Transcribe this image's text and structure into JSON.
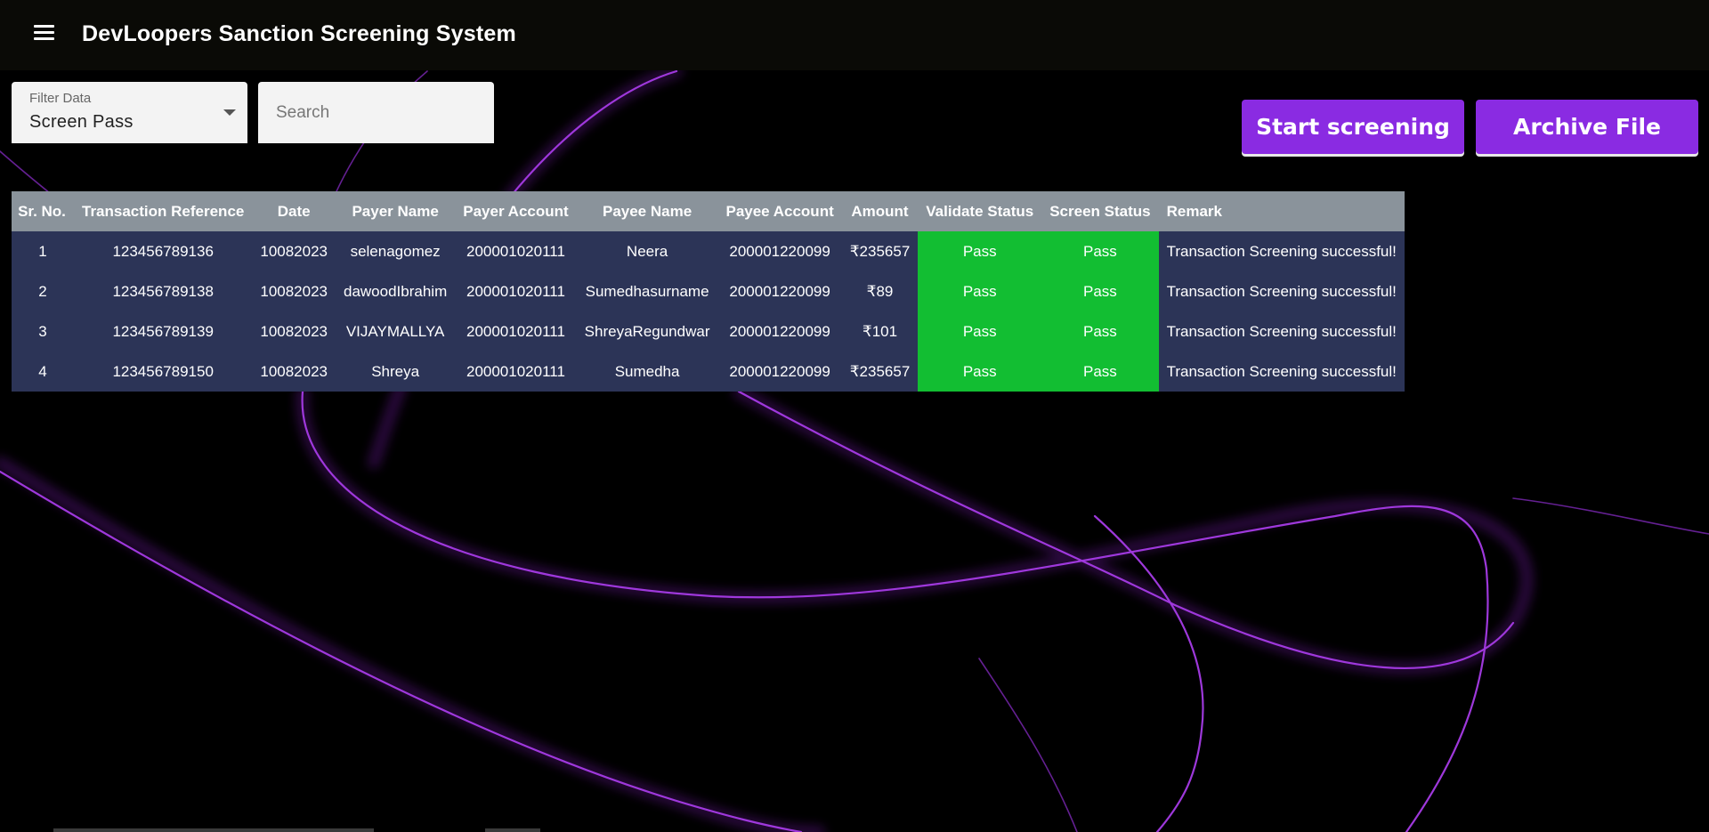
{
  "header": {
    "title": "DevLoopers Sanction Screening System",
    "menu_icon": "menu-icon"
  },
  "filter": {
    "label": "Filter Data",
    "value": "Screen Pass"
  },
  "search": {
    "placeholder": "Search"
  },
  "actions": {
    "start_label": "Start screening",
    "archive_label": "Archive File"
  },
  "colors": {
    "accent": "#8a2be2",
    "pass": "#12be32",
    "table_header": "#8a939b",
    "table_row": "#2c3457"
  },
  "table": {
    "columns": [
      "Sr. No.",
      "Transaction Reference",
      "Date",
      "Payer Name",
      "Payer Account",
      "Payee Name",
      "Payee Account",
      "Amount",
      "Validate Status",
      "Screen Status",
      "Remark"
    ],
    "rows": [
      [
        "1",
        "123456789136",
        "10082023",
        "selenagomez",
        "200001020111",
        "Neera",
        "200001220099",
        "₹235657",
        "Pass",
        "Pass",
        "Transaction Screening successful!"
      ],
      [
        "2",
        "123456789138",
        "10082023",
        "dawoodIbrahim",
        "200001020111",
        "Sumedhasurname",
        "200001220099",
        "₹89",
        "Pass",
        "Pass",
        "Transaction Screening successful!"
      ],
      [
        "3",
        "123456789139",
        "10082023",
        "VIJAYMALLYA",
        "200001020111",
        "ShreyaRegundwar",
        "200001220099",
        "₹101",
        "Pass",
        "Pass",
        "Transaction Screening successful!"
      ],
      [
        "4",
        "123456789150",
        "10082023",
        "Shreya",
        "200001020111",
        "Sumedha",
        "200001220099",
        "₹235657",
        "Pass",
        "Pass",
        "Transaction Screening successful!"
      ]
    ]
  }
}
